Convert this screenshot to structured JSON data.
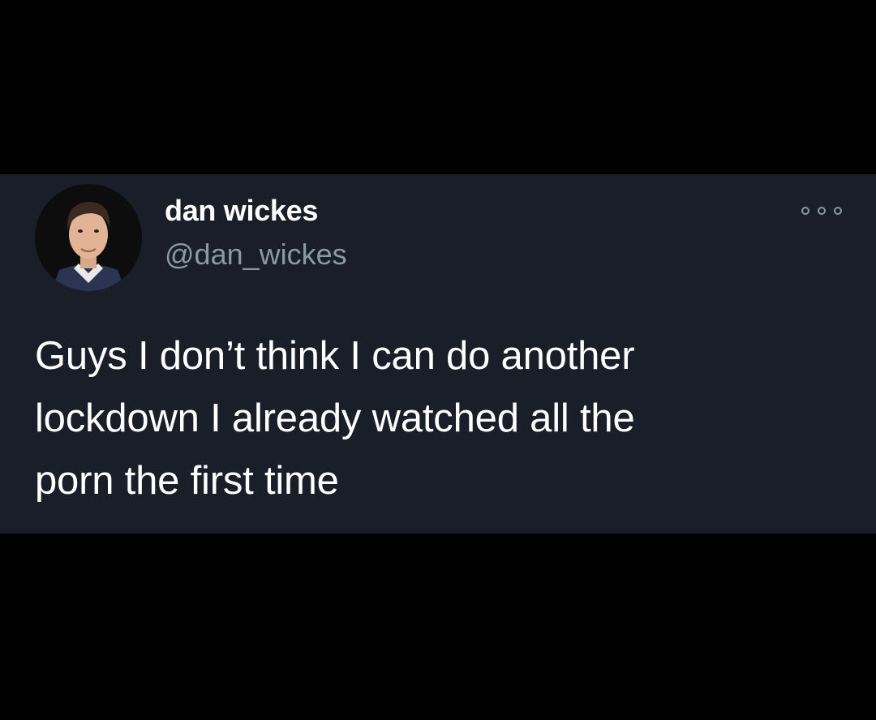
{
  "tweet": {
    "author": {
      "display_name": "dan wickes",
      "handle": "@dan_wickes",
      "avatar_icon": "profile-photo"
    },
    "text_lines": [
      "Guys I don’t think I can do another",
      "lockdown I already watched all the",
      "porn the first time"
    ],
    "more_icon": "more-options-icon"
  },
  "colors": {
    "page_background": "#000000",
    "card_background": "#1a1e29",
    "primary_text": "#ffffff",
    "secondary_text": "#8b98a5"
  }
}
